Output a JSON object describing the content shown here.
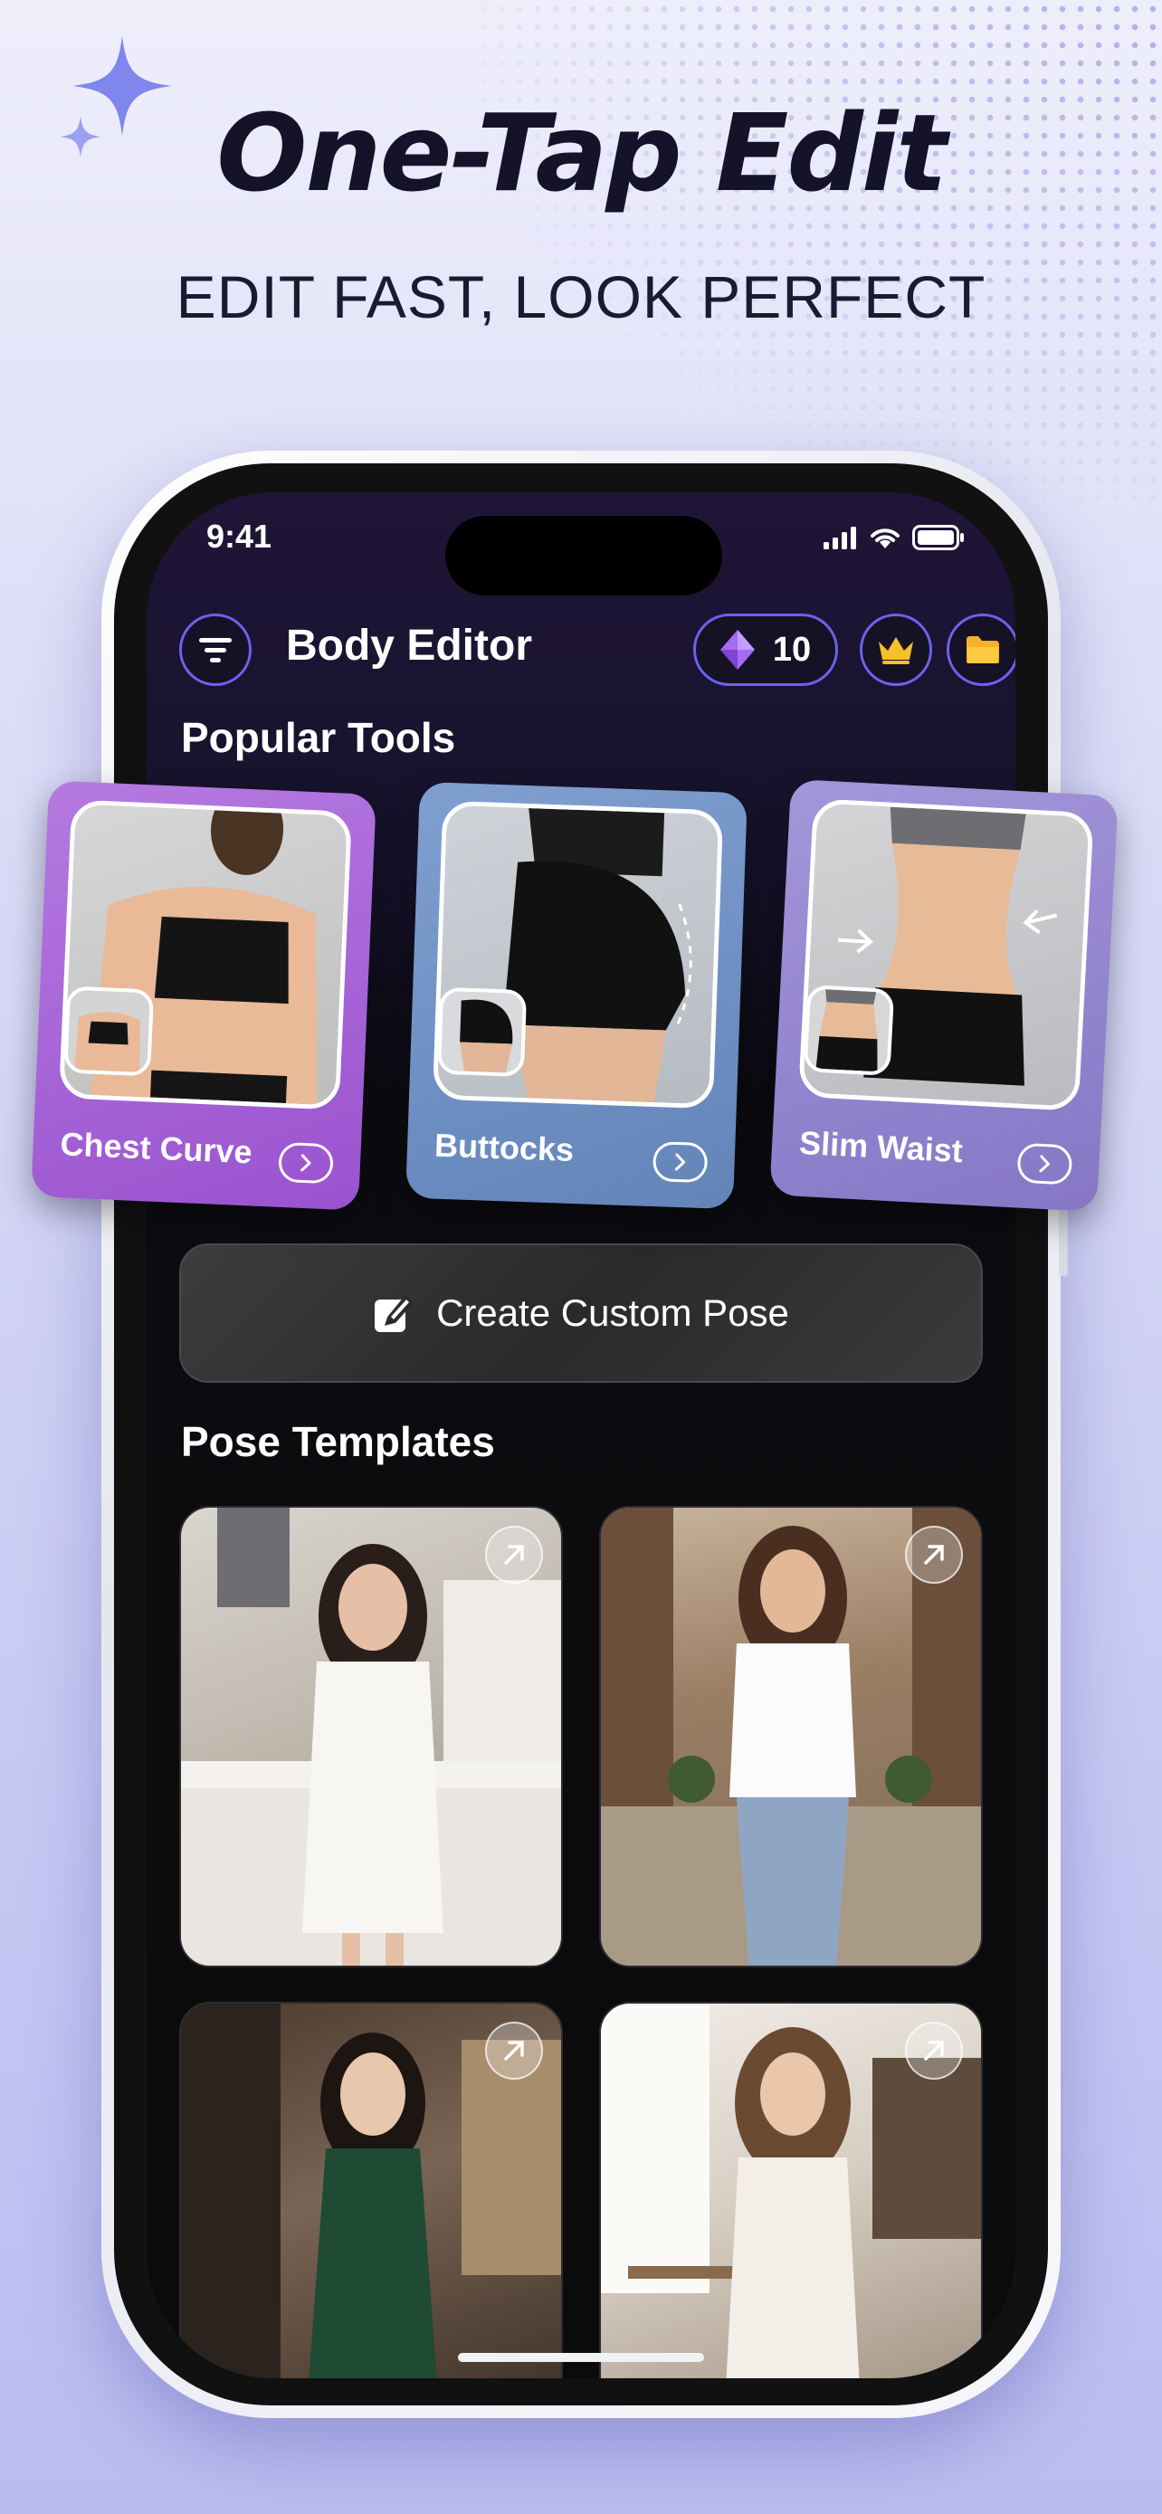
{
  "promo": {
    "headline": "One-Tap Edit",
    "subheadline": "EDIT FAST, LOOK PERFECT"
  },
  "status_bar": {
    "time": "9:41"
  },
  "app": {
    "title": "Body Editor",
    "gem_count": "10",
    "accent_color": "#6c62ee",
    "icons": [
      "filter-icon",
      "diamond-gem-icon",
      "crown-icon",
      "folder-icon"
    ]
  },
  "popular_tools": {
    "title": "Popular Tools",
    "items": [
      {
        "label": "Chest Curve",
        "color": "#a45ed4",
        "icon": "chevron-right-icon"
      },
      {
        "label": "Buttocks",
        "color": "#6f93c4",
        "icon": "chevron-right-icon"
      },
      {
        "label": "Slim Waist",
        "color": "#9487cf",
        "icon": "chevron-right-icon"
      }
    ]
  },
  "create_button": {
    "label": "Create Custom Pose",
    "icon": "edit-note-icon"
  },
  "pose_templates": {
    "title": "Pose Templates",
    "items": [
      {
        "scene": "kitchen",
        "icon": "arrow-up-right-icon"
      },
      {
        "scene": "street",
        "icon": "arrow-up-right-icon"
      },
      {
        "scene": "cafe-green-dress",
        "icon": "arrow-up-right-icon"
      },
      {
        "scene": "cafe-white-top",
        "icon": "arrow-up-right-icon"
      }
    ]
  }
}
